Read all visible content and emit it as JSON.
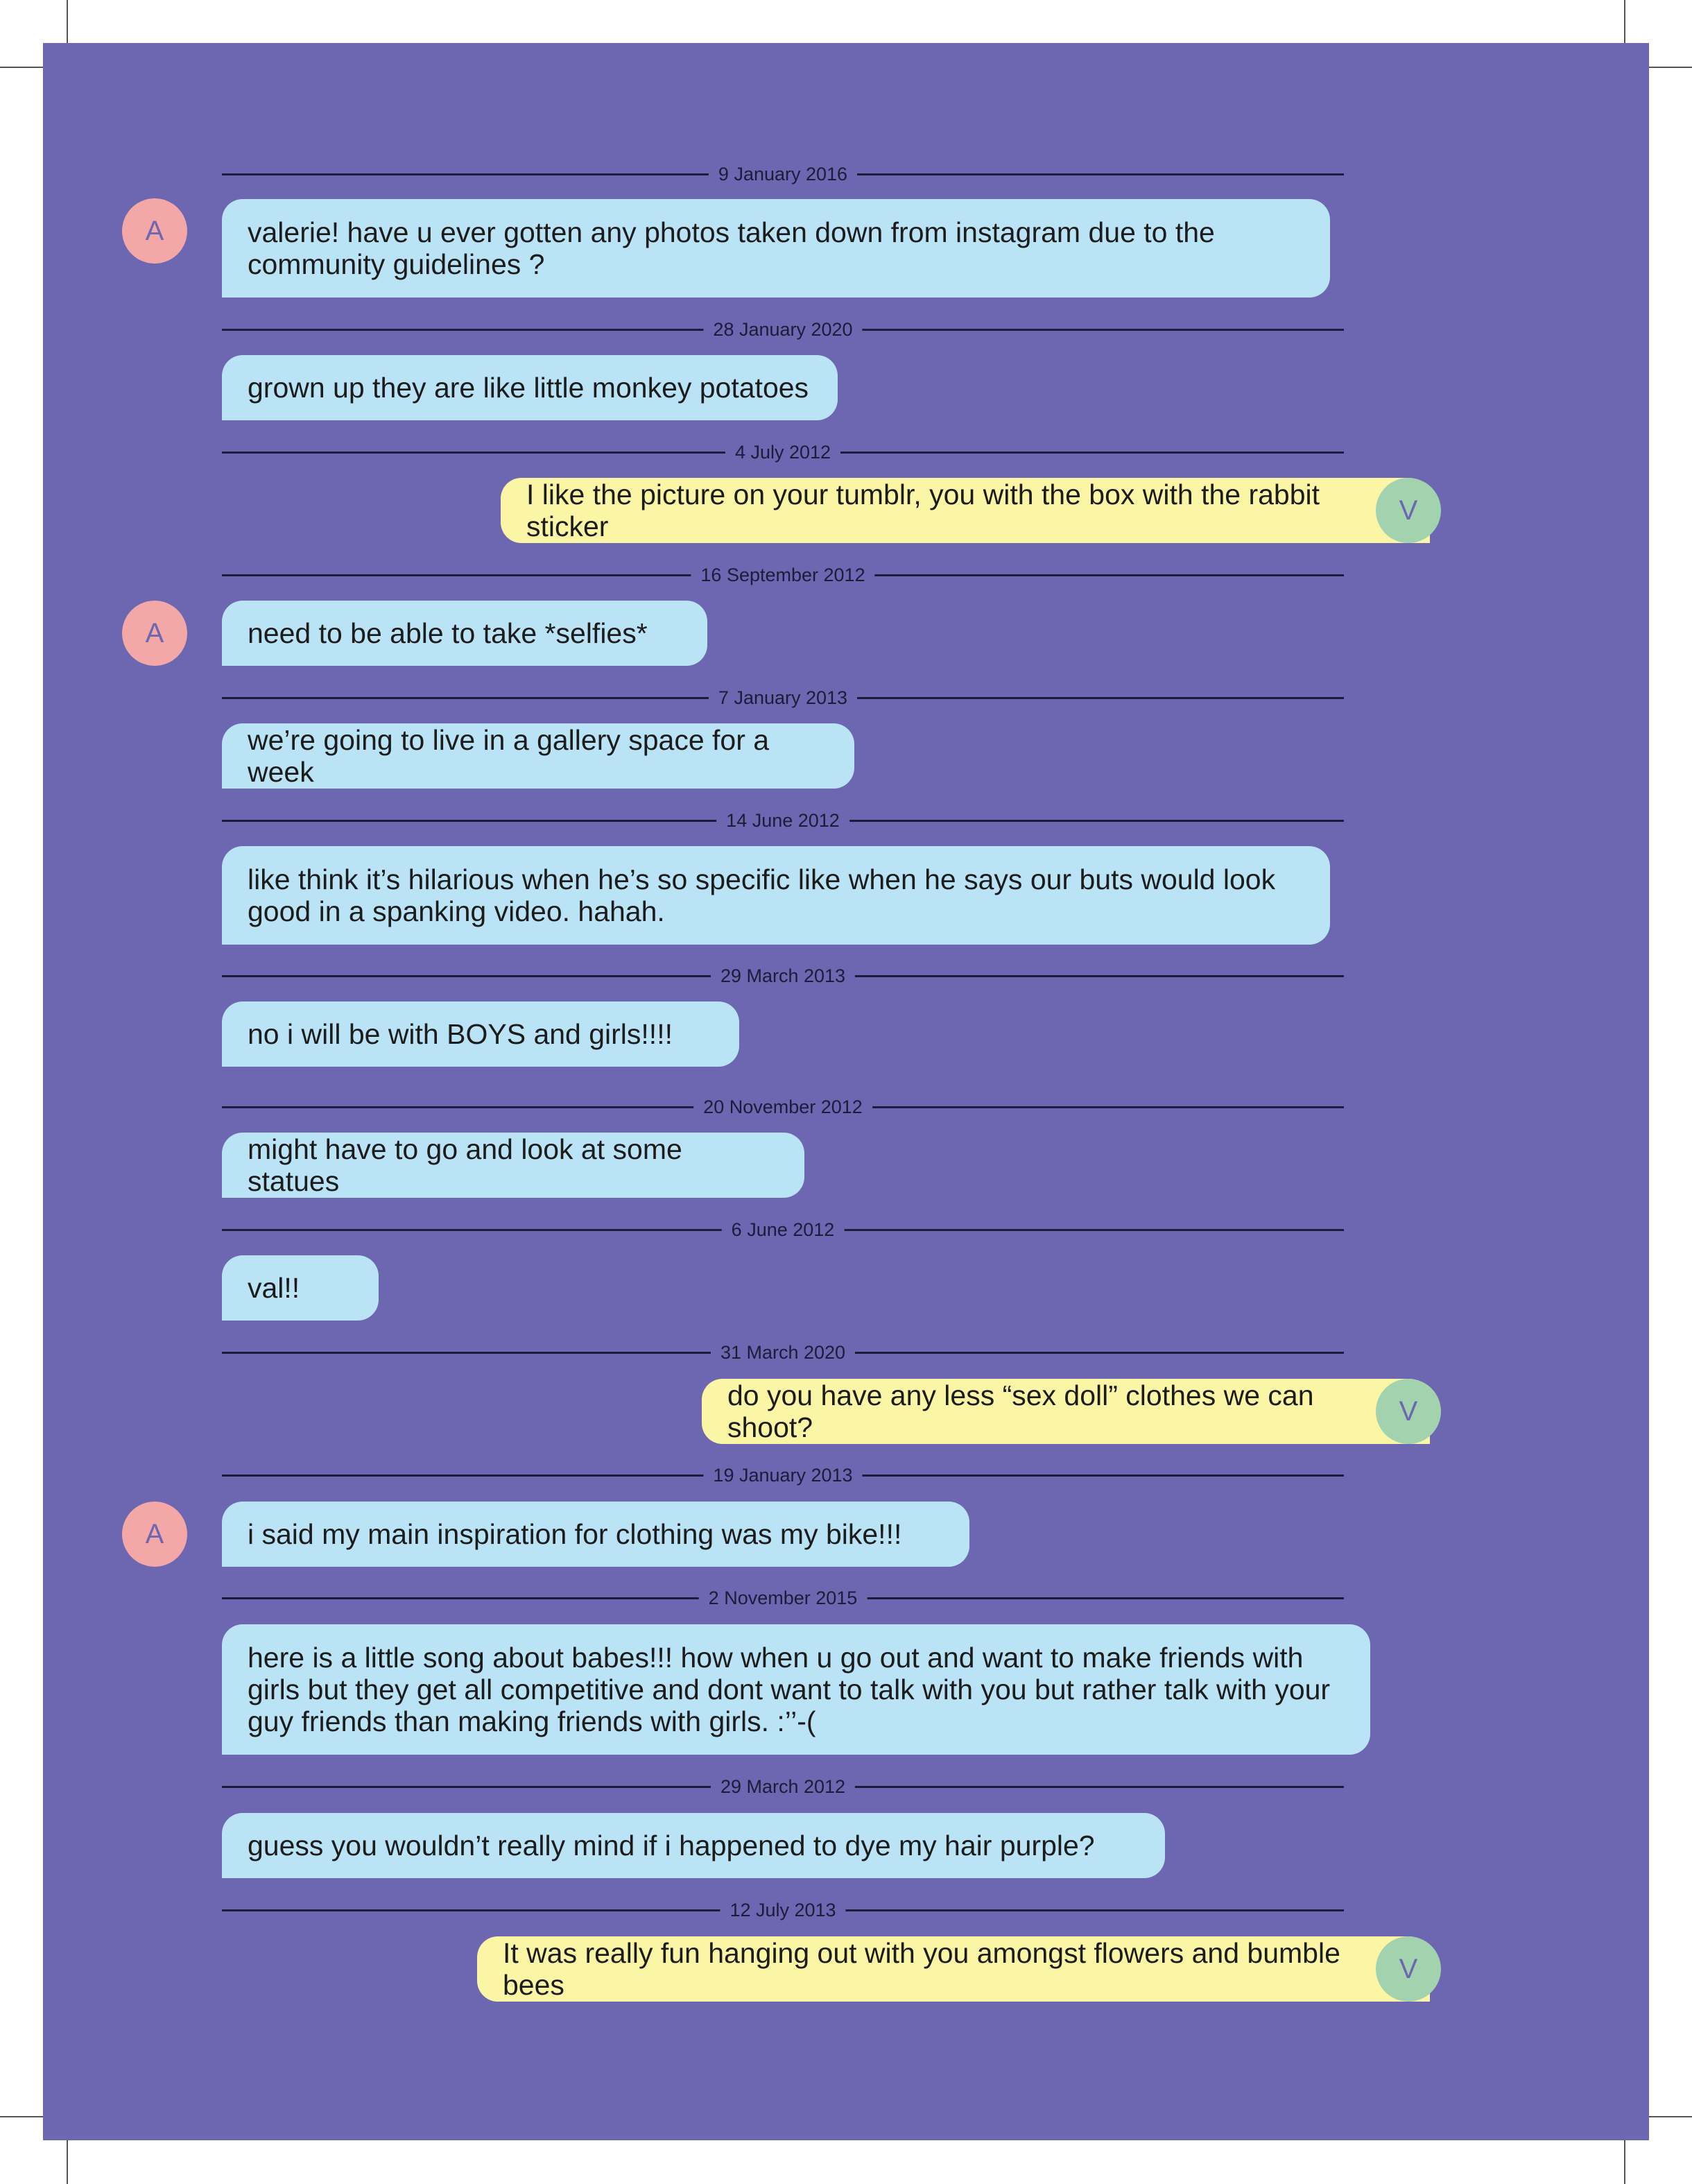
{
  "avatars": {
    "a_initial": "A",
    "v_initial": "V"
  },
  "messages": [
    {
      "date": "9 January 2016",
      "sender": "A",
      "text": "valerie! have u ever gotten any photos taken down from instagram due to the community guidelines ?"
    },
    {
      "date": "28 January 2020",
      "sender": "A",
      "text": "grown up they are like little monkey potatoes"
    },
    {
      "date": "4 July 2012",
      "sender": "V",
      "text": "I like the picture on your tumblr, you with the box with the rabbit sticker"
    },
    {
      "date": "16 September 2012",
      "sender": "A",
      "text": "need to be able to take *selfies*"
    },
    {
      "date": "7 January 2013",
      "sender": "A",
      "text": "we’re going to live in a gallery space for a week"
    },
    {
      "date": "14 June 2012",
      "sender": "A",
      "text": "like think it’s hilarious when he’s so specific like when he says our buts would look good in a spanking video. hahah."
    },
    {
      "date": "29 March 2013",
      "sender": "A",
      "text": "no i will be with BOYS and girls!!!!"
    },
    {
      "date": "20 November 2012",
      "sender": "A",
      "text": "might have to go and look at some statues"
    },
    {
      "date": "6 June 2012",
      "sender": "A",
      "text": "val!!"
    },
    {
      "date": "31 March 2020",
      "sender": "V",
      "text": "do you have any less “sex doll” clothes we can shoot?"
    },
    {
      "date": "19 January 2013",
      "sender": "A",
      "text": "i said my main inspiration for clothing was my bike!!!"
    },
    {
      "date": "2 November 2015",
      "sender": "A",
      "text": "here is a little song about babes!!! how when u go out and want to make friends with girls but they get all competitive and dont want to talk with you but rather talk with your guy friends than making friends with girls. :’’-("
    },
    {
      "date": "29 March 2012",
      "sender": "A",
      "text": "guess you wouldn’t really mind if i happened to dye my hair purple?"
    },
    {
      "date": "12 July 2013",
      "sender": "V",
      "text": "It was really fun hanging out with you amongst flowers and bumble bees"
    }
  ],
  "colors": {
    "background": "#6c67b0",
    "a_bubble": "#bbe3f6",
    "v_bubble": "#fbf5a6",
    "a_avatar": "#f4a7a7",
    "v_avatar": "#a3d2ae"
  }
}
